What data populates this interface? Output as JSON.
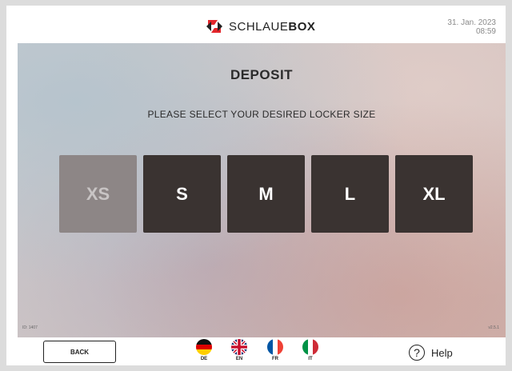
{
  "header": {
    "brand_light": "SCHLAUE",
    "brand_bold": "BOX",
    "date": "31. Jan. 2023",
    "time": "08:59"
  },
  "main": {
    "title": "DEPOSIT",
    "subtitle": "PLEASE SELECT YOUR DESIRED LOCKER SIZE",
    "sizes": [
      {
        "label": "XS",
        "enabled": false
      },
      {
        "label": "S",
        "enabled": true
      },
      {
        "label": "M",
        "enabled": true
      },
      {
        "label": "L",
        "enabled": true
      },
      {
        "label": "XL",
        "enabled": true
      }
    ],
    "id_label": "ID: 1407",
    "version": "v2.5.1"
  },
  "footer": {
    "back_label": "BACK",
    "languages": [
      {
        "code": "DE",
        "icon": "germany-flag-icon"
      },
      {
        "code": "EN",
        "icon": "uk-flag-icon"
      },
      {
        "code": "FR",
        "icon": "france-flag-icon"
      },
      {
        "code": "IT",
        "icon": "italy-flag-icon"
      }
    ],
    "help_label": "Help",
    "help_icon": "?"
  },
  "colors": {
    "button_dark": "#3a3331",
    "button_disabled": "#8d8686",
    "brand_red": "#e3262b"
  }
}
